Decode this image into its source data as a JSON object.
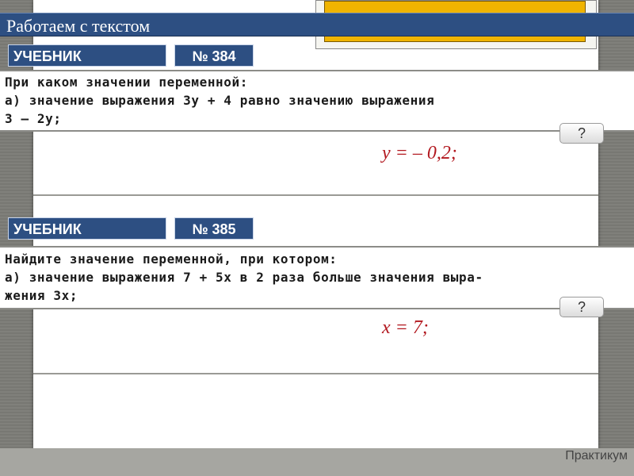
{
  "header": {
    "title": "Работаем с текстом"
  },
  "tasks": [
    {
      "source_label": "УЧЕБНИК",
      "number_label": "№ 384",
      "lines": [
        "При каком значении переменной:",
        "а) значение выражения 3y + 4 равно значению выражения",
        "3 – 2y;"
      ],
      "help_label": "?",
      "answer": "y  = – 0,2;"
    },
    {
      "source_label": "УЧЕБНИК",
      "number_label": "№ 385",
      "lines": [
        "Найдите значение переменной, при котором:",
        "а) значение выражения 7 + 5x в 2 раза больше значения выра-",
        "жения 3x;"
      ],
      "help_label": "?",
      "answer": "x  = 7;"
    }
  ],
  "footer": {
    "label": "Практикум"
  },
  "colors": {
    "accent": "#2d4f82",
    "answer": "#b2181f",
    "gold": "#f0b400"
  }
}
